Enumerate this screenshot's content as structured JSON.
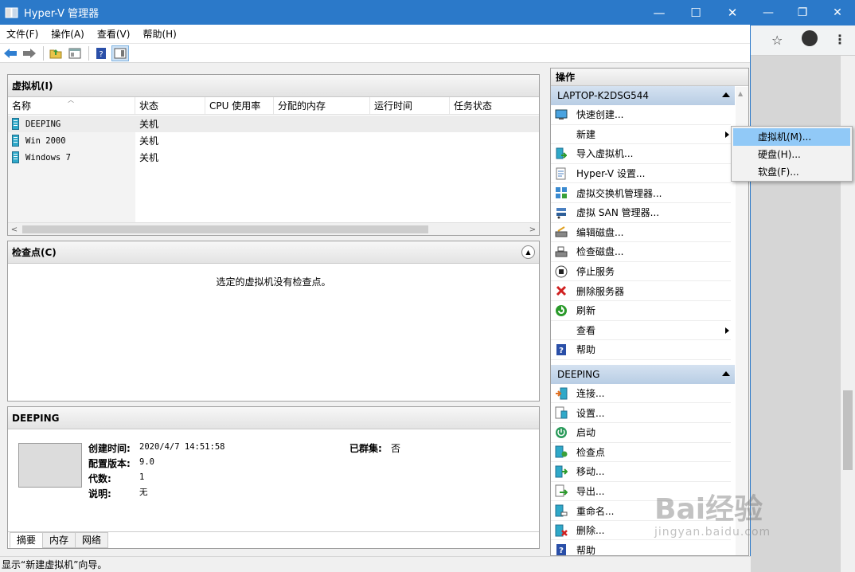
{
  "window": {
    "title": "Hyper-V 管理器",
    "minimize_glyph": "—",
    "maximize_glyph": "☐",
    "close_glyph": "✕"
  },
  "menu": [
    "文件(F)",
    "操作(A)",
    "查看(V)",
    "帮助(H)"
  ],
  "toolbar": {
    "icons": [
      "back-arrow-icon",
      "forward-arrow-icon",
      "up-folder-icon",
      "show-hide-console-tree-icon",
      "help-icon",
      "action-pane-icon"
    ]
  },
  "vm_pane": {
    "title": "虚拟机(I)",
    "columns": [
      "名称",
      "状态",
      "CPU 使用率",
      "分配的内存",
      "运行时间",
      "任务状态"
    ],
    "rows": [
      {
        "name": "DEEPING",
        "state": "关机"
      },
      {
        "name": "Win 2000",
        "state": "关机"
      },
      {
        "name": "Windows 7",
        "state": "关机"
      }
    ]
  },
  "checkpoint_pane": {
    "title": "检查点(C)",
    "empty_message": "选定的虚拟机没有检查点。"
  },
  "detail_pane": {
    "title": "DEEPING",
    "fields": [
      {
        "key": "创建时间:",
        "value": "2020/4/7 14:51:58"
      },
      {
        "key": "配置版本:",
        "value": "9.0"
      },
      {
        "key": "代数:",
        "value": "1"
      },
      {
        "key": "说明:",
        "value": "无"
      }
    ],
    "clustered": {
      "key": "已群集:",
      "value": "否"
    },
    "tabs": [
      "摘要",
      "内存",
      "网络"
    ]
  },
  "actions_pane": {
    "title": "操作",
    "server_group": {
      "title": "LAPTOP-K2DSG544",
      "items": [
        {
          "label": "快速创建...",
          "icon": "quick-create-icon"
        },
        {
          "label": "新建",
          "icon": "",
          "submenu": true
        },
        {
          "label": "导入虚拟机...",
          "icon": "import-vm-icon"
        },
        {
          "label": "Hyper-V 设置...",
          "icon": "hyperv-settings-icon"
        },
        {
          "label": "虚拟交换机管理器...",
          "icon": "virtual-switch-icon"
        },
        {
          "label": "虚拟 SAN 管理器...",
          "icon": "virtual-san-icon"
        },
        {
          "label": "编辑磁盘...",
          "icon": "edit-disk-icon"
        },
        {
          "label": "检查磁盘...",
          "icon": "inspect-disk-icon"
        },
        {
          "label": "停止服务",
          "icon": "stop-service-icon"
        },
        {
          "label": "删除服务器",
          "icon": "remove-server-icon"
        },
        {
          "label": "刷新",
          "icon": "refresh-icon"
        },
        {
          "label": "查看",
          "icon": "",
          "submenu": true
        },
        {
          "label": "帮助",
          "icon": "help-icon"
        }
      ]
    },
    "vm_group": {
      "title": "DEEPING",
      "items": [
        {
          "label": "连接...",
          "icon": "connect-icon"
        },
        {
          "label": "设置...",
          "icon": "settings-icon"
        },
        {
          "label": "启动",
          "icon": "start-icon"
        },
        {
          "label": "检查点",
          "icon": "checkpoint-icon"
        },
        {
          "label": "移动...",
          "icon": "move-icon"
        },
        {
          "label": "导出...",
          "icon": "export-icon"
        },
        {
          "label": "重命名...",
          "icon": "rename-icon"
        },
        {
          "label": "删除...",
          "icon": "delete-icon"
        },
        {
          "label": "帮助",
          "icon": "help-icon"
        }
      ]
    }
  },
  "context_menu": {
    "items": [
      "虚拟机(M)...",
      "硬盘(H)...",
      "软盘(F)..."
    ],
    "highlighted_index": 0
  },
  "status_bar": {
    "text": "显示“新建虚拟机”向导。"
  },
  "watermark": {
    "logo_text": "Bai经验",
    "url_text": "jingyan.baidu.com"
  },
  "colors": {
    "titlebar": "#2b79c9",
    "group_header": "#c6d7ea",
    "menu_highlight": "#91c9f7"
  }
}
